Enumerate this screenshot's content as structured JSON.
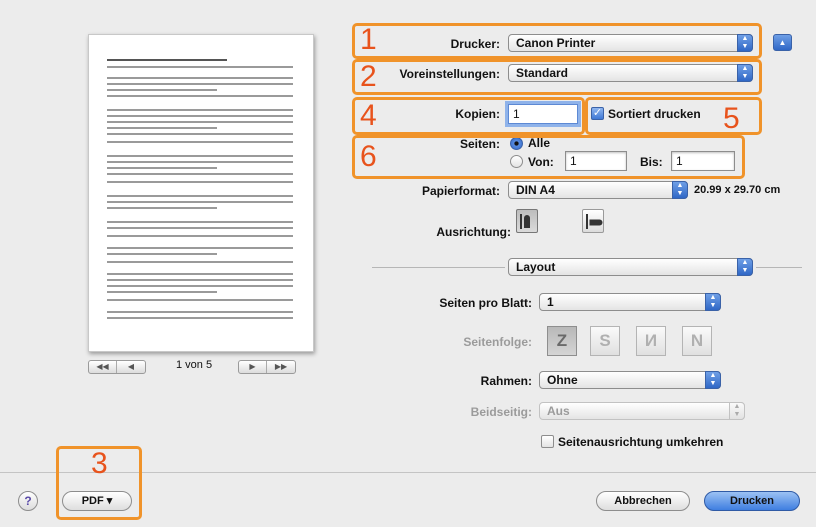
{
  "printer": {
    "label": "Drucker:",
    "value": "Canon Printer"
  },
  "presets": {
    "label": "Voreinstellungen:",
    "value": "Standard"
  },
  "copies": {
    "label": "Kopien:",
    "value": "1"
  },
  "collate": {
    "label": "Sortiert drucken",
    "checked": true
  },
  "pages": {
    "label": "Seiten:",
    "all_label": "Alle",
    "from_label": "Von:",
    "from_value": "1",
    "to_label": "Bis:",
    "to_value": "1"
  },
  "paper": {
    "label": "Papierformat:",
    "value": "DIN A4",
    "size": "20.99 x 29.70 cm"
  },
  "orientation": {
    "label": "Ausrichtung:"
  },
  "section_popup": {
    "value": "Layout"
  },
  "layout": {
    "pages_per_sheet_label": "Seiten pro Blatt:",
    "pages_per_sheet_value": "1",
    "page_order_label": "Seitenfolge:",
    "border_label": "Rahmen:",
    "border_value": "Ohne",
    "two_sided_label": "Beidseitig:",
    "two_sided_value": "Aus",
    "reverse_label": "Seitenausrichtung umkehren"
  },
  "preview": {
    "page_count": "1 von 5"
  },
  "bottom": {
    "help": "?",
    "pdf": "PDF ▾",
    "cancel": "Abbrechen",
    "print": "Drucken"
  },
  "callouts": [
    "1",
    "2",
    "3",
    "4",
    "5",
    "6"
  ],
  "colors": {
    "callout": "#f0932a",
    "callout_number": "#e8531c",
    "accent": "#3f7ee0"
  }
}
